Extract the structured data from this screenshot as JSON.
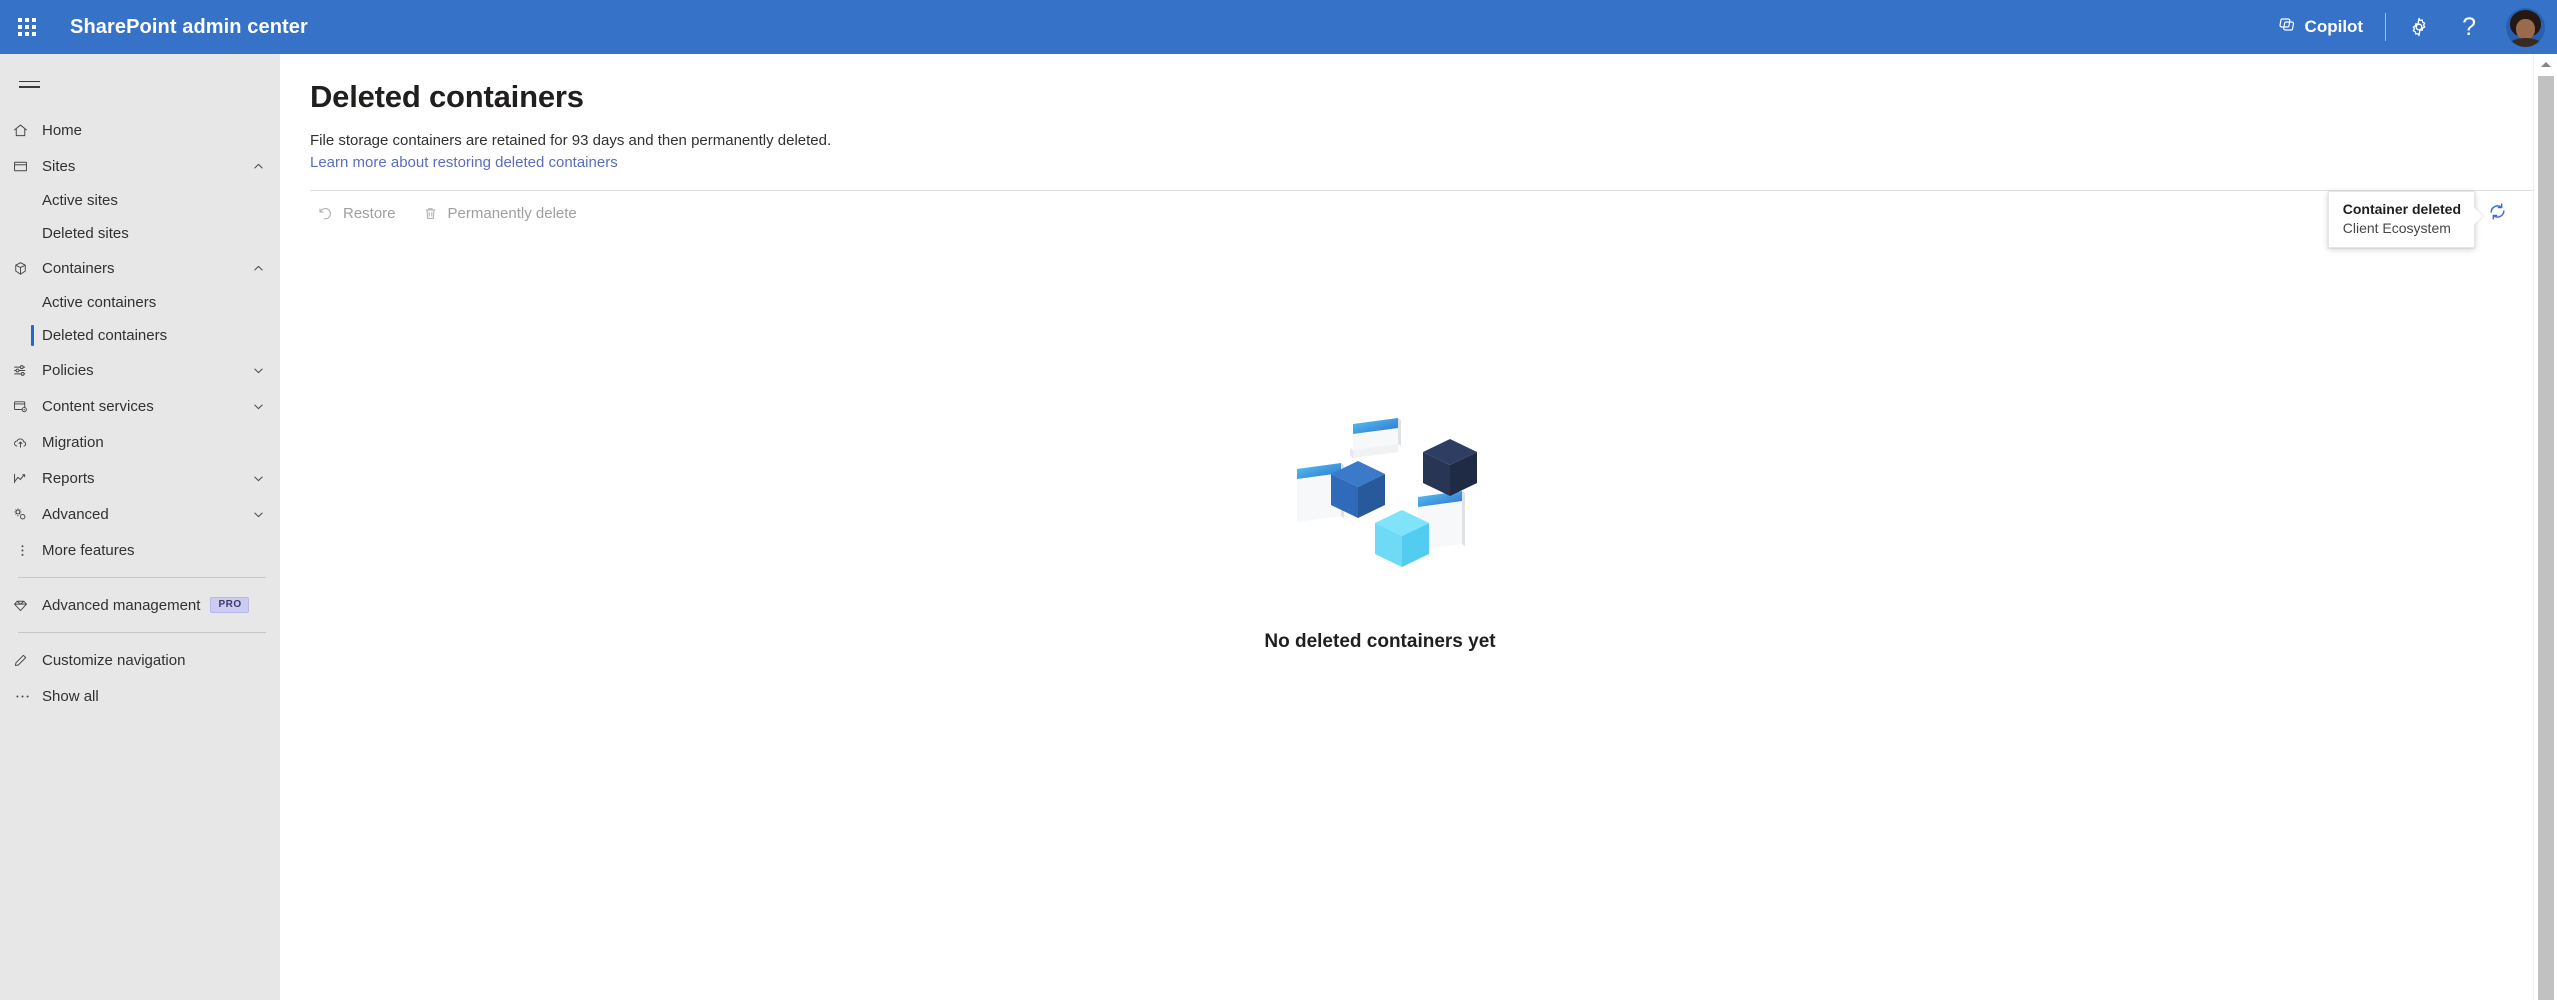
{
  "header": {
    "waffle_icon": "app-launcher-waffle-icon",
    "title": "SharePoint admin center",
    "copilot_label": "Copilot",
    "copilot_icon": "copilot-icon",
    "settings_icon": "gear-icon",
    "help_icon": "question-mark-icon",
    "help_label": "?",
    "avatar_label": "user-avatar",
    "brand_color": "#3672c8"
  },
  "sidebar": {
    "hamburger_icon": "hamburger-menu-icon",
    "items": [
      {
        "label": "Home",
        "icon": "home-icon",
        "type": "item",
        "expandable": false
      },
      {
        "label": "Sites",
        "icon": "sites-window-icon",
        "type": "item",
        "expandable": true,
        "expanded": true
      },
      {
        "label": "Active sites",
        "type": "sub",
        "selected": false
      },
      {
        "label": "Deleted sites",
        "type": "sub",
        "selected": false
      },
      {
        "label": "Containers",
        "icon": "container-box-icon",
        "type": "item",
        "expandable": true,
        "expanded": true
      },
      {
        "label": "Active containers",
        "type": "sub",
        "selected": false
      },
      {
        "label": "Deleted containers",
        "type": "sub",
        "selected": true
      },
      {
        "label": "Policies",
        "icon": "sliders-icon",
        "type": "item",
        "expandable": true,
        "expanded": false
      },
      {
        "label": "Content services",
        "icon": "content-services-icon",
        "type": "item",
        "expandable": true,
        "expanded": false
      },
      {
        "label": "Migration",
        "icon": "cloud-upload-icon",
        "type": "item",
        "expandable": false
      },
      {
        "label": "Reports",
        "icon": "line-chart-icon",
        "type": "item",
        "expandable": true,
        "expanded": false
      },
      {
        "label": "Advanced",
        "icon": "advanced-gears-icon",
        "type": "item",
        "expandable": true,
        "expanded": false
      },
      {
        "label": "More features",
        "icon": "more-vertical-icon",
        "type": "item",
        "expandable": false
      }
    ],
    "advanced_management": {
      "label": "Advanced management",
      "icon": "diamond-icon",
      "badge": "PRO",
      "badge_bg": "#ccccf2",
      "badge_color": "#3a3a6b"
    },
    "footer_items": [
      {
        "label": "Customize navigation",
        "icon": "pencil-edit-icon"
      },
      {
        "label": "Show all",
        "icon": "ellipsis-icon"
      }
    ],
    "selected_indicator_color": "#2266cf",
    "background": "#e7e7e7"
  },
  "main": {
    "page_title": "Deleted containers",
    "description": "File storage containers are retained for 93 days and then permanently deleted.",
    "link_text": "Learn more about restoring deleted containers",
    "link_color": "#5a6ebd",
    "commands": [
      {
        "label": "Restore",
        "icon": "restore-undo-icon",
        "disabled": true
      },
      {
        "label": "Permanently delete",
        "icon": "trash-delete-icon",
        "disabled": true
      }
    ],
    "refresh_icon": "refresh-circular-arrows-icon",
    "tooltip": {
      "title": "Container deleted",
      "subtitle": "Client Ecosystem"
    },
    "empty_state": {
      "illustration": "isometric-cubes-and-cards-illustration",
      "text": "No deleted containers yet"
    },
    "scrollbar": {
      "up_arrow_icon": "scroll-up-arrow-icon",
      "thumb_label": "vertical-scroll-thumb"
    }
  }
}
